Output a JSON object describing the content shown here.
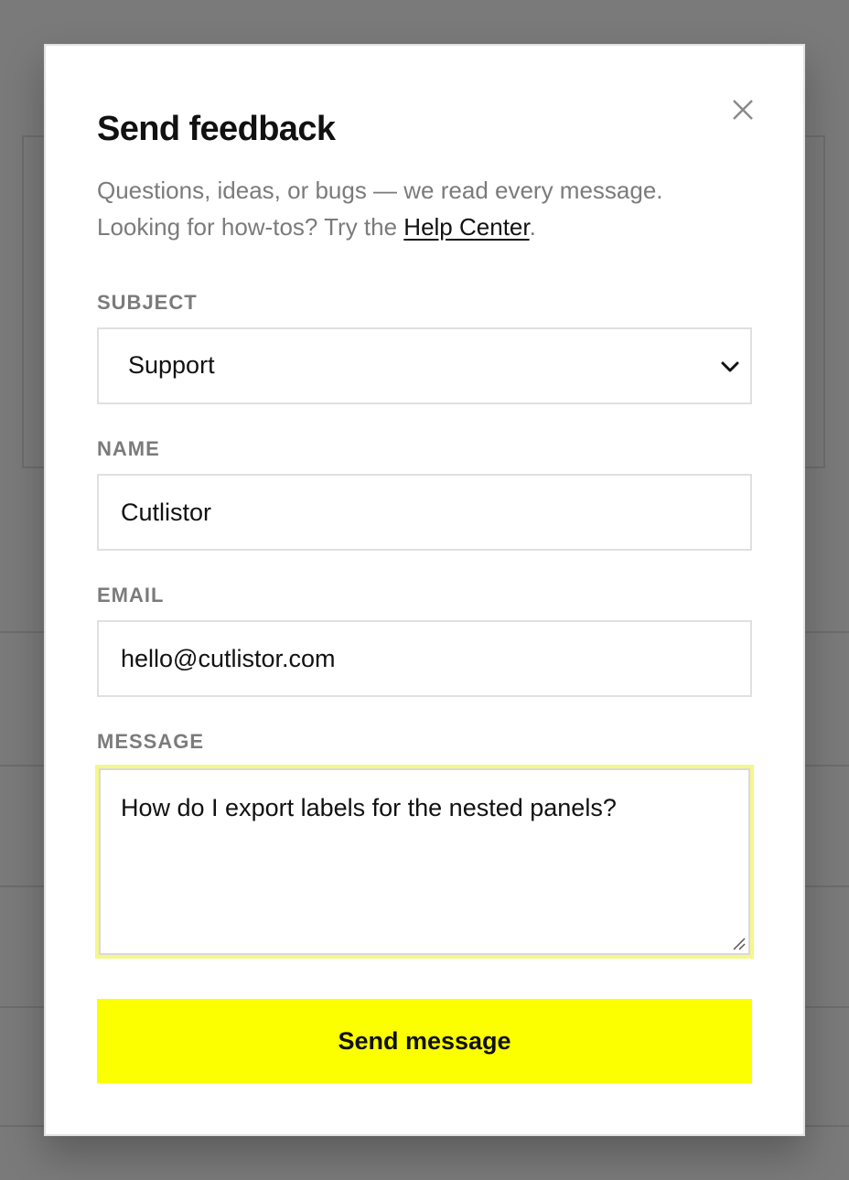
{
  "modal": {
    "title": "Send feedback",
    "intro_line1": "Questions, ideas, or bugs — we read every message.",
    "intro_line2_prefix": "Looking for how-tos? Try the ",
    "help_link": "Help Center",
    "intro_line2_suffix": ".",
    "close_icon": "close-icon"
  },
  "form": {
    "subject": {
      "label": "SUBJECT",
      "value": "Support",
      "icon": "chevron-down-icon"
    },
    "name": {
      "label": "NAME",
      "value": "Cutlistor"
    },
    "email": {
      "label": "EMAIL",
      "value": "hello@cutlistor.com"
    },
    "message": {
      "label": "MESSAGE",
      "value": "How do I export labels for the nested panels?"
    },
    "submit_label": "Send message"
  },
  "colors": {
    "accent": "#fbff00",
    "focus_ring": "#f5f78a",
    "overlay": "#7a7a7a",
    "muted_text": "#7b7b7b",
    "text": "#111111"
  }
}
